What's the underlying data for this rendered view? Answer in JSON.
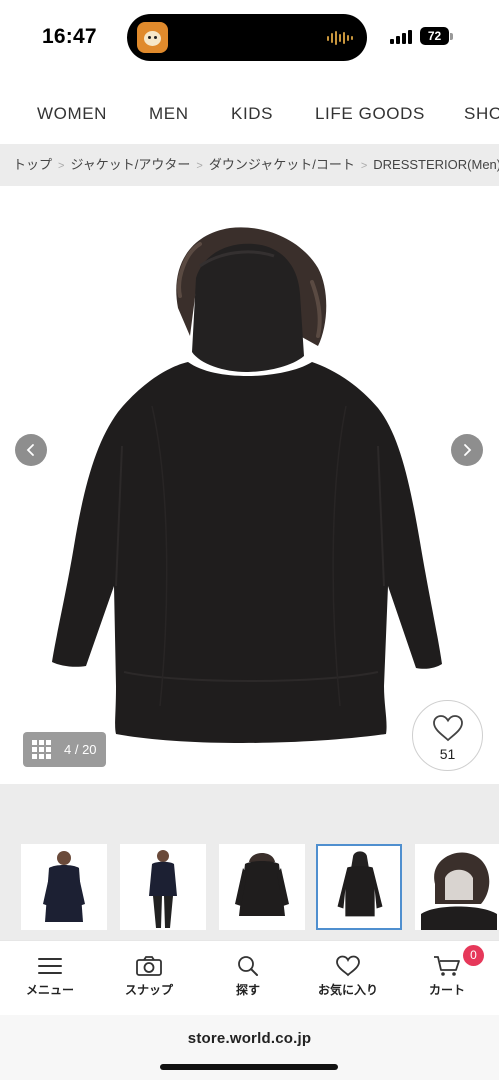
{
  "status_bar": {
    "time": "16:47",
    "battery": "72"
  },
  "category_nav": {
    "items": [
      "WOMEN",
      "MEN",
      "KIDS",
      "LIFE GOODS",
      "SHO"
    ]
  },
  "breadcrumb": {
    "items": [
      "トップ",
      "ジャケット/アウター",
      "ダウンジャケット/コート",
      "DRESSTERIOR(Men)"
    ]
  },
  "product_image": {
    "counter": "4 / 20",
    "favorite_count": "51"
  },
  "tab_bar": {
    "items": [
      "メニュー",
      "スナップ",
      "探す",
      "お気に入り",
      "カート"
    ],
    "cart_badge": "0"
  },
  "browser": {
    "address": "store.world.co.jp"
  },
  "colors": {
    "accent_badge": "#e6385a",
    "active_thumb_border": "#4f8fcf",
    "breadcrumb_bg": "#ececec"
  },
  "icons": [
    "chevron-left-icon",
    "chevron-right-icon",
    "grid-icon",
    "heart-icon",
    "menu-icon",
    "camera-icon",
    "search-icon",
    "cart-icon"
  ]
}
